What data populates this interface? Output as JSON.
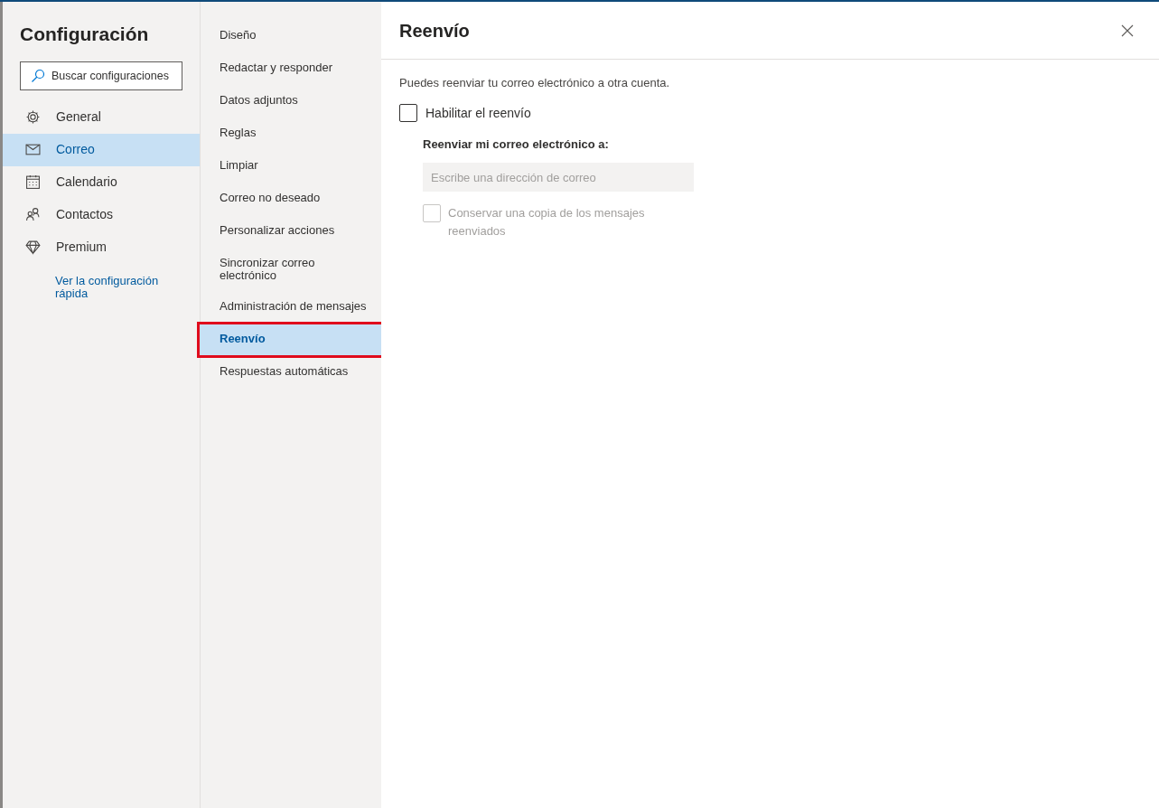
{
  "title": "Configuración",
  "search": {
    "placeholder": "Buscar configuraciones"
  },
  "nav": [
    {
      "label": "General",
      "selected": false
    },
    {
      "label": "Correo",
      "selected": true
    },
    {
      "label": "Calendario",
      "selected": false
    },
    {
      "label": "Contactos",
      "selected": false
    },
    {
      "label": "Premium",
      "selected": false
    }
  ],
  "quick_settings_link": "Ver la configuración rápida",
  "subnav": [
    {
      "label": "Diseño",
      "selected": false,
      "highlighted": false
    },
    {
      "label": "Redactar y responder",
      "selected": false,
      "highlighted": false
    },
    {
      "label": "Datos adjuntos",
      "selected": false,
      "highlighted": false
    },
    {
      "label": "Reglas",
      "selected": false,
      "highlighted": false
    },
    {
      "label": "Limpiar",
      "selected": false,
      "highlighted": false
    },
    {
      "label": "Correo no deseado",
      "selected": false,
      "highlighted": false
    },
    {
      "label": "Personalizar acciones",
      "selected": false,
      "highlighted": false
    },
    {
      "label": "Sincronizar correo electrónico",
      "selected": false,
      "highlighted": false
    },
    {
      "label": "Administración de mensajes",
      "selected": false,
      "highlighted": false
    },
    {
      "label": "Reenvío",
      "selected": true,
      "highlighted": true
    },
    {
      "label": "Respuestas automáticas",
      "selected": false,
      "highlighted": false
    }
  ],
  "panel": {
    "title": "Reenvío",
    "description": "Puedes reenviar tu correo electrónico a otra cuenta.",
    "enable": {
      "label": "Habilitar el reenvío",
      "checked": false
    },
    "forward_to_label": "Reenviar mi correo electrónico a:",
    "address_field": {
      "placeholder": "Escribe una dirección de correo",
      "disabled": true
    },
    "keep_copy": {
      "label": "Conservar una copia de los mensajes reenviados",
      "checked": false,
      "disabled": true
    }
  }
}
